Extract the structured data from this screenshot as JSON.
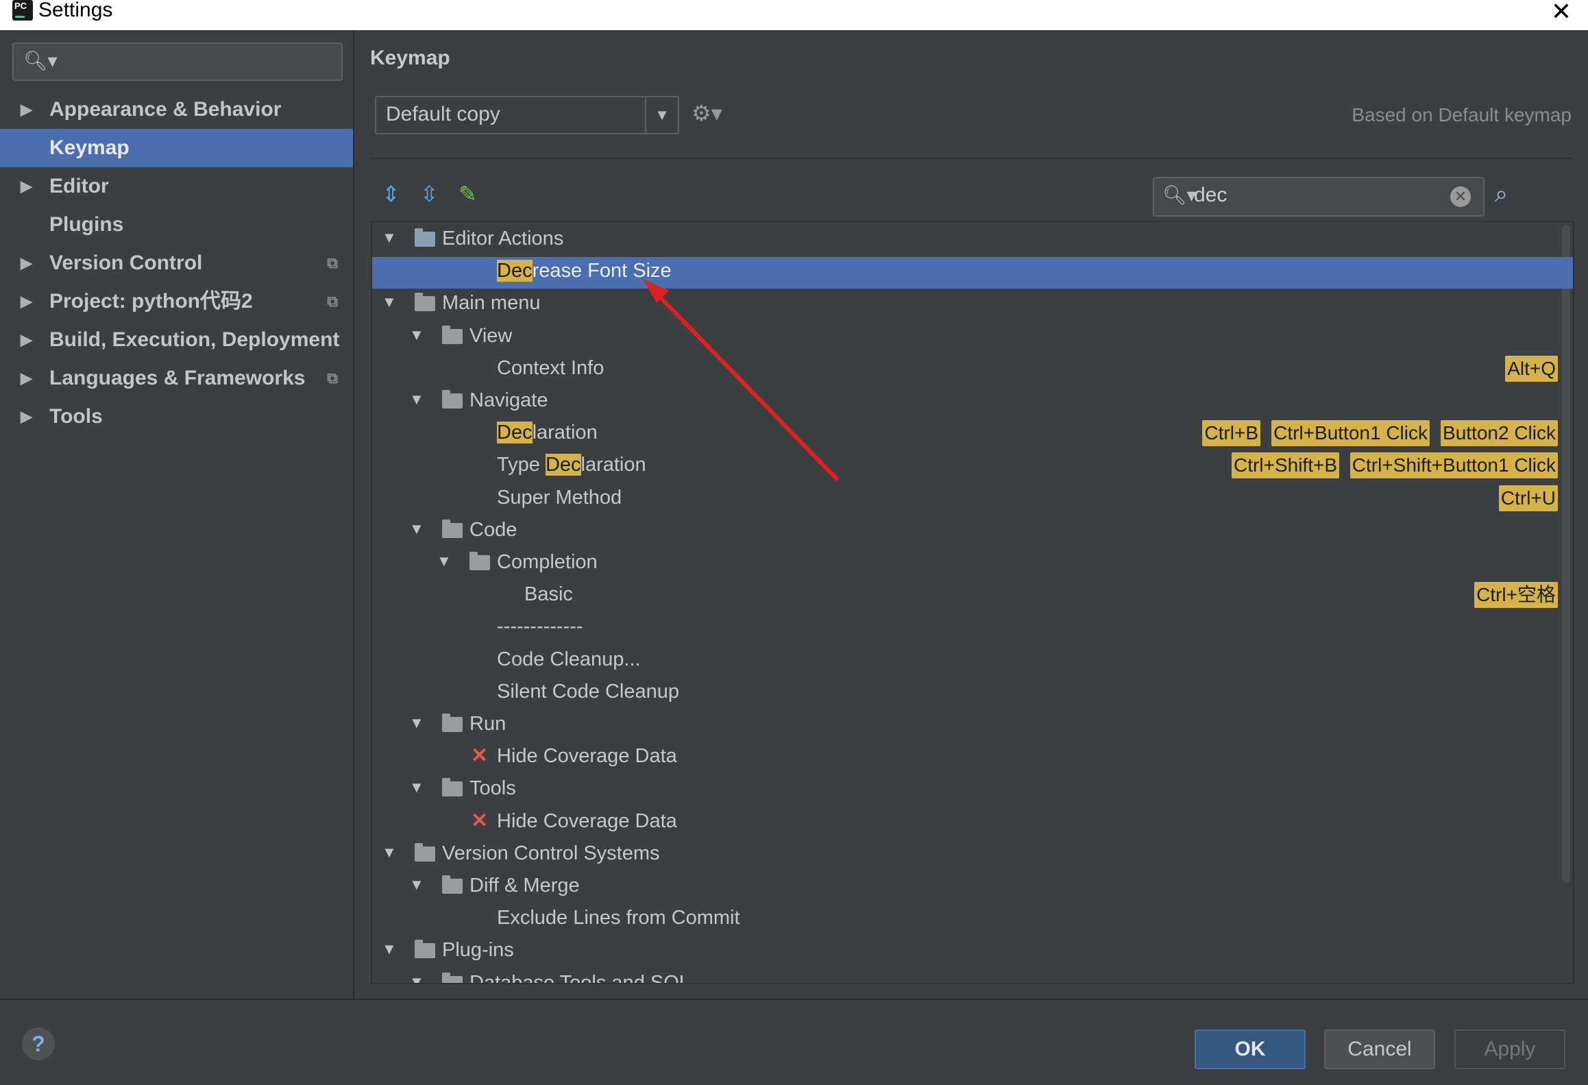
{
  "window": {
    "title": "Settings",
    "logo_text": "PC"
  },
  "sidebar": {
    "items": [
      {
        "label": "Appearance & Behavior",
        "expandable": true,
        "copy_icon": false,
        "selected": false
      },
      {
        "label": "Keymap",
        "expandable": false,
        "copy_icon": false,
        "selected": true
      },
      {
        "label": "Editor",
        "expandable": true,
        "copy_icon": false,
        "selected": false
      },
      {
        "label": "Plugins",
        "expandable": false,
        "copy_icon": false,
        "selected": false
      },
      {
        "label": "Version Control",
        "expandable": true,
        "copy_icon": true,
        "selected": false
      },
      {
        "label": "Project: python代码2",
        "expandable": true,
        "copy_icon": true,
        "selected": false
      },
      {
        "label": "Build, Execution, Deployment",
        "expandable": true,
        "copy_icon": false,
        "selected": false
      },
      {
        "label": "Languages & Frameworks",
        "expandable": true,
        "copy_icon": true,
        "selected": false
      },
      {
        "label": "Tools",
        "expandable": true,
        "copy_icon": false,
        "selected": false
      }
    ]
  },
  "main": {
    "title": "Keymap",
    "keymap_select": "Default copy",
    "based_on": "Based on Default keymap",
    "search_value": "dec"
  },
  "tree": [
    {
      "level": 0,
      "expanded": true,
      "icon": "editor-actions",
      "text": "Editor Actions",
      "highlight": "",
      "selected": false,
      "shortcuts": []
    },
    {
      "level": 2,
      "expanded": null,
      "icon": "none",
      "text": "Decrease Font Size",
      "highlight": "Dec",
      "selected": true,
      "shortcuts": []
    },
    {
      "level": 0,
      "expanded": true,
      "icon": "menu",
      "text": "Main menu",
      "highlight": "",
      "selected": false,
      "shortcuts": []
    },
    {
      "level": 1,
      "expanded": true,
      "icon": "folder",
      "text": "View",
      "highlight": "",
      "selected": false,
      "shortcuts": []
    },
    {
      "level": 2,
      "expanded": null,
      "icon": "none",
      "text": "Context Info",
      "highlight": "",
      "selected": false,
      "shortcuts": [
        "Alt+Q"
      ]
    },
    {
      "level": 1,
      "expanded": true,
      "icon": "folder",
      "text": "Navigate",
      "highlight": "",
      "selected": false,
      "shortcuts": []
    },
    {
      "level": 2,
      "expanded": null,
      "icon": "none",
      "text": "Declaration",
      "highlight": "Dec",
      "selected": false,
      "shortcuts": [
        "Ctrl+B",
        "Ctrl+Button1 Click",
        "Button2 Click"
      ]
    },
    {
      "level": 2,
      "expanded": null,
      "icon": "none",
      "text": "Type Declaration",
      "highlight": "Dec",
      "selected": false,
      "shortcuts": [
        "Ctrl+Shift+B",
        "Ctrl+Shift+Button1 Click"
      ]
    },
    {
      "level": 2,
      "expanded": null,
      "icon": "none",
      "text": "Super Method",
      "highlight": "",
      "selected": false,
      "shortcuts": [
        "Ctrl+U"
      ]
    },
    {
      "level": 1,
      "expanded": true,
      "icon": "folder",
      "text": "Code",
      "highlight": "",
      "selected": false,
      "shortcuts": []
    },
    {
      "level": 2,
      "expanded": true,
      "icon": "folder",
      "text": "Completion",
      "highlight": "",
      "selected": false,
      "shortcuts": []
    },
    {
      "level": 3,
      "expanded": null,
      "icon": "none",
      "text": "Basic",
      "highlight": "",
      "selected": false,
      "shortcuts": [
        "Ctrl+空格"
      ]
    },
    {
      "level": 2,
      "expanded": null,
      "icon": "none",
      "text": "-------------",
      "highlight": "",
      "selected": false,
      "shortcuts": []
    },
    {
      "level": 2,
      "expanded": null,
      "icon": "none",
      "text": "Code Cleanup...",
      "highlight": "",
      "selected": false,
      "shortcuts": []
    },
    {
      "level": 2,
      "expanded": null,
      "icon": "none",
      "text": "Silent Code Cleanup",
      "highlight": "",
      "selected": false,
      "shortcuts": []
    },
    {
      "level": 1,
      "expanded": true,
      "icon": "folder",
      "text": "Run",
      "highlight": "",
      "selected": false,
      "shortcuts": []
    },
    {
      "level": 2,
      "expanded": null,
      "icon": "x",
      "text": "Hide Coverage Data",
      "highlight": "",
      "selected": false,
      "shortcuts": []
    },
    {
      "level": 1,
      "expanded": true,
      "icon": "folder",
      "text": "Tools",
      "highlight": "",
      "selected": false,
      "shortcuts": []
    },
    {
      "level": 2,
      "expanded": null,
      "icon": "x",
      "text": "Hide Coverage Data",
      "highlight": "",
      "selected": false,
      "shortcuts": []
    },
    {
      "level": 0,
      "expanded": true,
      "icon": "folder",
      "text": "Version Control Systems",
      "highlight": "",
      "selected": false,
      "shortcuts": []
    },
    {
      "level": 1,
      "expanded": true,
      "icon": "folder",
      "text": "Diff & Merge",
      "highlight": "",
      "selected": false,
      "shortcuts": []
    },
    {
      "level": 2,
      "expanded": null,
      "icon": "none",
      "text": "Exclude Lines from Commit",
      "highlight": "",
      "selected": false,
      "shortcuts": []
    },
    {
      "level": 0,
      "expanded": true,
      "icon": "folder",
      "text": "Plug-ins",
      "highlight": "",
      "selected": false,
      "shortcuts": []
    },
    {
      "level": 1,
      "expanded": true,
      "icon": "folder",
      "text": "Database Tools and SQL",
      "highlight": "",
      "selected": false,
      "shortcuts": []
    }
  ],
  "footer": {
    "ok": "OK",
    "cancel": "Cancel",
    "apply": "Apply",
    "help": "?"
  },
  "colors": {
    "selection": "#4b6eaf",
    "highlight": "#d5b34a",
    "annotation_arrow": "#e02020"
  }
}
